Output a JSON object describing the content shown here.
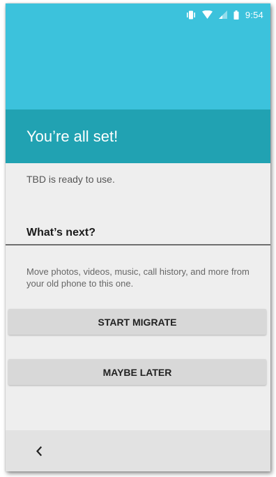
{
  "status_bar": {
    "time": "9:54",
    "icons": [
      "vibrate-icon",
      "wifi-icon",
      "signal-icon",
      "battery-icon"
    ],
    "color": "#3cc2dc"
  },
  "header": {
    "title": "You’re all set!",
    "color": "#21a2b2"
  },
  "main": {
    "ready_text": "TBD is ready to use.",
    "section_heading": "What’s next?",
    "description": "Move photos, videos, music, call history, and more from your old phone to this one."
  },
  "actions": {
    "start_label": "START MIGRATE",
    "later_label": "MAYBE LATER"
  },
  "nav": {
    "back_icon": "chevron-left-icon"
  }
}
